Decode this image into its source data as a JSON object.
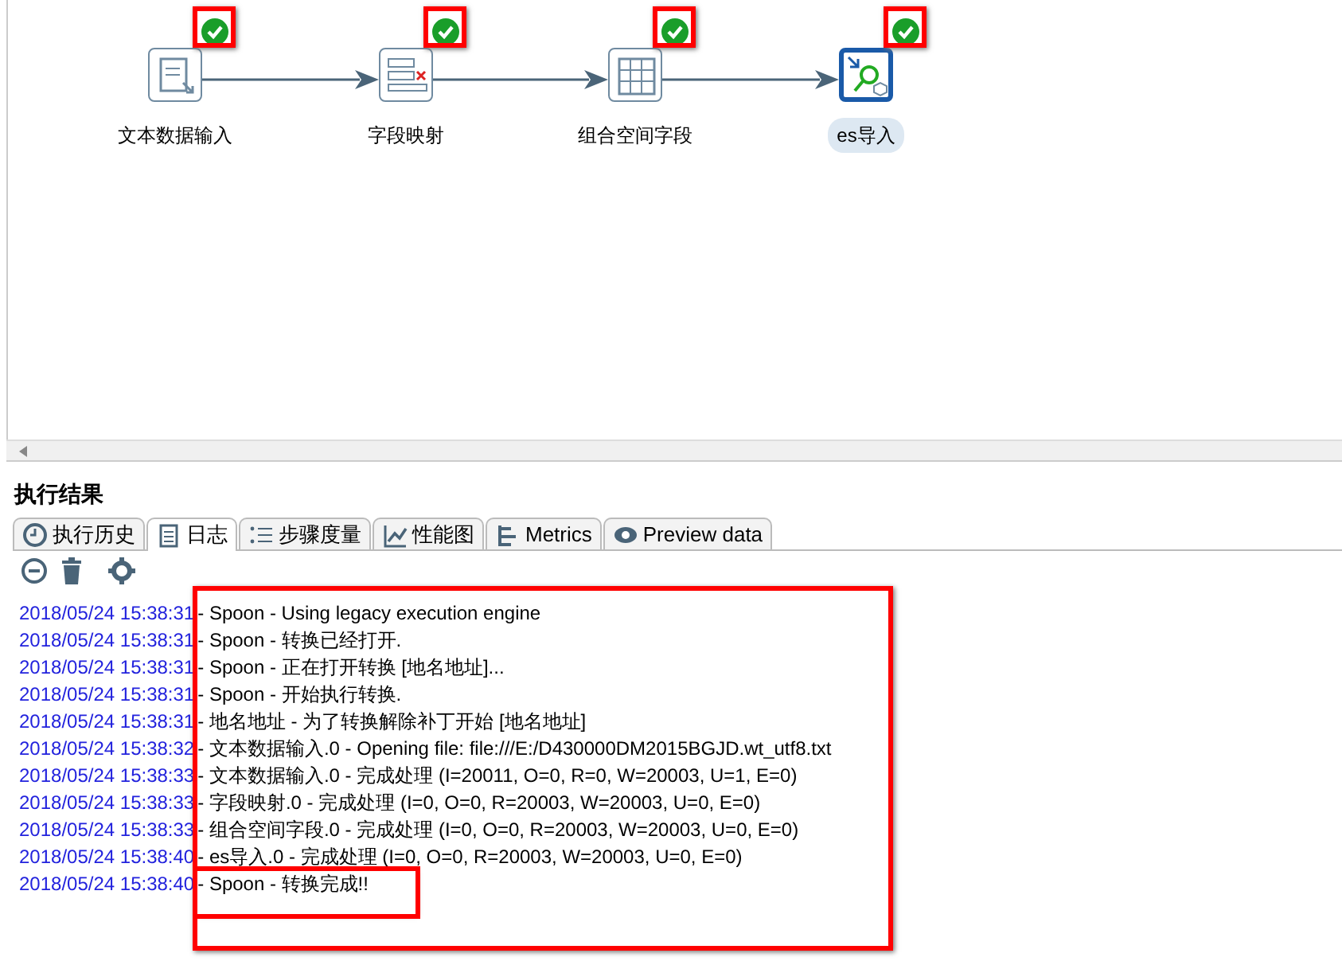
{
  "canvas": {
    "steps": [
      {
        "label": "文本数据输入",
        "kind": "text-input",
        "selected": false,
        "done": true,
        "highlighted": true
      },
      {
        "label": "字段映射",
        "kind": "mapping",
        "selected": false,
        "done": true,
        "highlighted": true
      },
      {
        "label": "组合空间字段",
        "kind": "grid",
        "selected": false,
        "done": true,
        "highlighted": true
      },
      {
        "label": "es导入",
        "kind": "search",
        "selected": true,
        "done": true,
        "highlighted": true
      }
    ]
  },
  "results": {
    "title": "执行结果",
    "tabs": [
      {
        "label": "执行历史",
        "selected": false
      },
      {
        "label": "日志",
        "selected": true
      },
      {
        "label": "步骤度量",
        "selected": false
      },
      {
        "label": "性能图",
        "selected": false
      },
      {
        "label": "Metrics",
        "selected": false
      },
      {
        "label": "Preview data",
        "selected": false
      }
    ],
    "log_highlighted": true,
    "log": [
      {
        "time": "2018/05/24 15:38:31",
        "text": "- Spoon - Using legacy execution engine",
        "highlighted": false
      },
      {
        "time": "2018/05/24 15:38:31",
        "text": "- Spoon - 转换已经打开.",
        "highlighted": false
      },
      {
        "time": "2018/05/24 15:38:31",
        "text": "- Spoon - 正在打开转换 [地名地址]...",
        "highlighted": false
      },
      {
        "time": "2018/05/24 15:38:31",
        "text": "- Spoon - 开始执行转换.",
        "highlighted": false
      },
      {
        "time": "2018/05/24 15:38:31",
        "text": "- 地名地址 - 为了转换解除补丁开始  [地名地址]",
        "highlighted": false
      },
      {
        "time": "2018/05/24 15:38:32",
        "text": "- 文本数据输入.0 - Opening file: file:///E:/D430000DM2015BGJD.wt_utf8.txt",
        "highlighted": false
      },
      {
        "time": "2018/05/24 15:38:33",
        "text": "- 文本数据输入.0 - 完成处理 (I=20011, O=0, R=0, W=20003, U=1, E=0)",
        "highlighted": false
      },
      {
        "time": "2018/05/24 15:38:33",
        "text": "- 字段映射.0 - 完成处理 (I=0, O=0, R=20003, W=20003, U=0, E=0)",
        "highlighted": false
      },
      {
        "time": "2018/05/24 15:38:33",
        "text": "- 组合空间字段.0 - 完成处理 (I=0, O=0, R=20003, W=20003, U=0, E=0)",
        "highlighted": false
      },
      {
        "time": "2018/05/24 15:38:40",
        "text": "- es导入.0 - 完成处理 (I=0, O=0, R=20003, W=20003, U=0, E=0)",
        "highlighted": false
      },
      {
        "time": "2018/05/24 15:38:40",
        "text": "- Spoon - 转换完成!!",
        "highlighted": true
      }
    ]
  }
}
